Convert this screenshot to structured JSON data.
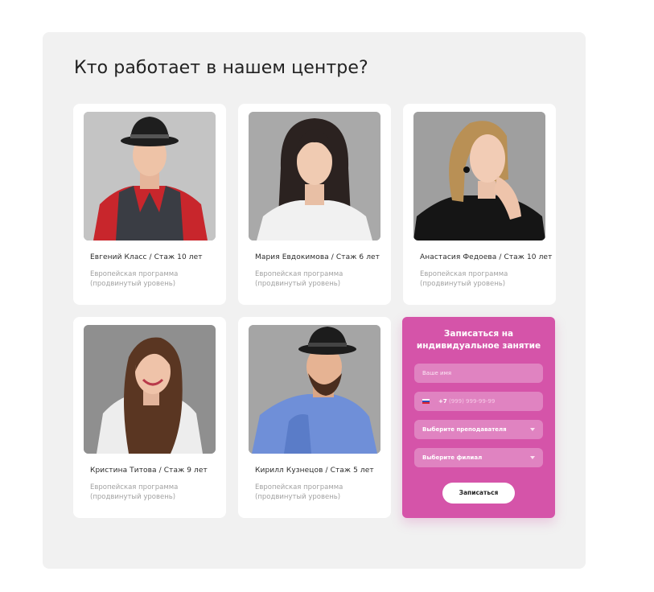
{
  "section": {
    "title": "Кто работает в нашем центре?"
  },
  "teachers": [
    {
      "name": "Евгений Класс / Стаж 10 лет",
      "program": "Европейская программа (продвинутый уровень)"
    },
    {
      "name": "Мария Евдокимова / Стаж 6 лет",
      "program": "Европейская программа (продвинутый уровень)"
    },
    {
      "name": "Анастасия Федоева / Стаж 10 лет",
      "program": "Европейская программа (продвинутый уровень)"
    },
    {
      "name": "Кристина Титова / Стаж 9 лет",
      "program": "Европейская программа (продвинутый уровень)"
    },
    {
      "name": "Кирилл Кузнецов / Стаж 5 лет",
      "program": "Европейская программа (продвинутый уровень)"
    }
  ],
  "form": {
    "title": "Записаться на индивидуальное занятие",
    "name_placeholder": "Ваше имя",
    "phone_code": "+7",
    "phone_mask": "(999) 999-99-99",
    "teacher_select": "Выберите преподавателя",
    "branch_select": "Выберите филиал",
    "submit_label": "Записаться"
  },
  "colors": {
    "form_bg": "#d554a9",
    "panel_bg": "#f1f1f1",
    "card_bg": "#ffffff"
  }
}
